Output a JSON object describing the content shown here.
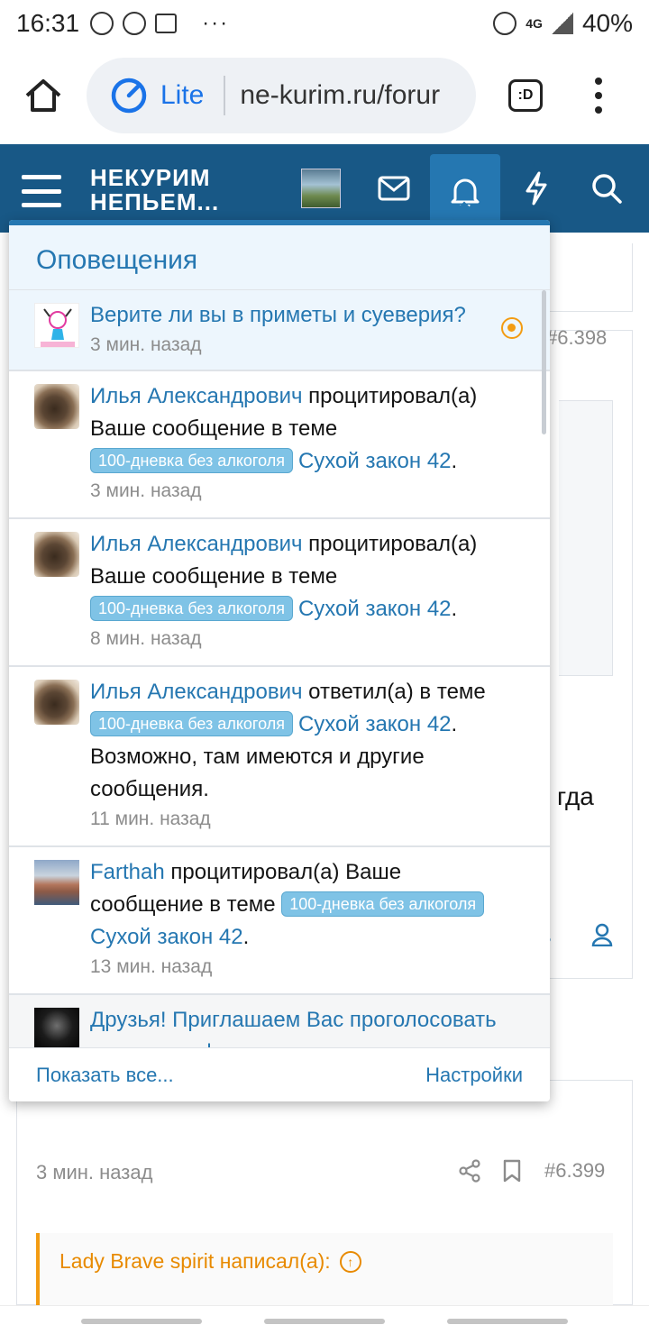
{
  "status_bar": {
    "time": "16:31",
    "dots": "···",
    "network": "4G",
    "battery": "40%"
  },
  "browser": {
    "lite_label": "Lite",
    "url": "ne-kurim.ru/forur",
    "tabs_label": ":D"
  },
  "site": {
    "logo_line1": "НЕКУРИМ",
    "logo_line2": "НЕПЬЕМ..."
  },
  "background": {
    "post_number_1": "#6.398",
    "partial_word": "гда",
    "partial_link": "ь",
    "time_2": "3 мин. назад",
    "post_number_2": "#6.399",
    "quote_author": "Lady Brave spirit написал(а):"
  },
  "notifications": {
    "title": "Оповещения",
    "items": [
      {
        "thread_link": "Верите ли вы в приметы и суеверия?",
        "time": "3 мин. назад",
        "unread": true
      },
      {
        "user": "Илья Александрович",
        "action": " процитировал(а) Ваше сообщение в теме ",
        "prefix": "100-дневка без алкоголя",
        "thread": "Сухой закон 42",
        "suffix": ".",
        "time": "3 мин. назад"
      },
      {
        "user": "Илья Александрович",
        "action": " процитировал(а) Ваше сообщение в теме ",
        "prefix": "100-дневка без алкоголя",
        "thread": "Сухой закон 42",
        "suffix": ".",
        "time": "8 мин. назад"
      },
      {
        "user": "Илья Александрович",
        "action": " ответил(а) в теме ",
        "prefix": "100-дневка без алкоголя",
        "thread": "Сухой закон 42",
        "suffix": ". Возможно, там имеются и другие сообщения.",
        "time": "11 мин. назад"
      },
      {
        "user": "Farthah",
        "action": " процитировал(а) Ваше сообщение в теме ",
        "prefix": "100-дневка без алкоголя",
        "thread": "Сухой закон 42",
        "suffix": ".",
        "time": "13 мин. назад"
      },
      {
        "thread_link": "Друзья! Приглашаем Вас проголосовать за лучшее фото"
      }
    ],
    "show_all": "Показать все...",
    "settings": "Настройки"
  }
}
